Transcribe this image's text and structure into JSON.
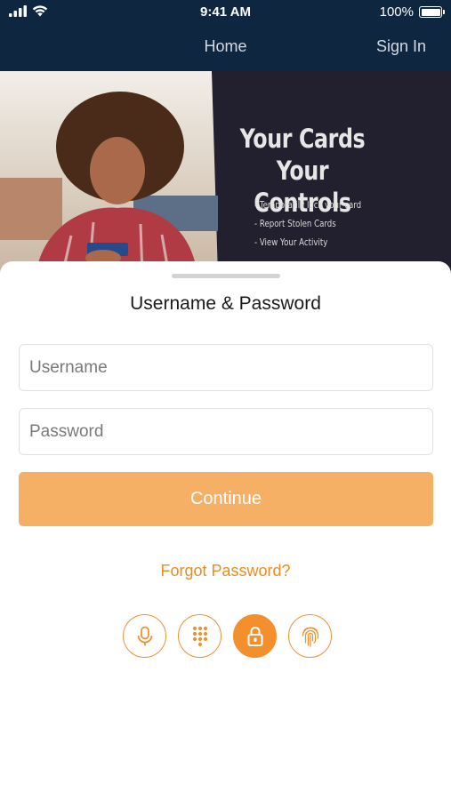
{
  "status_bar": {
    "time": "9:41 AM",
    "battery": "100%"
  },
  "nav": {
    "home": "Home",
    "sign_in": "Sign In"
  },
  "banner": {
    "tagline_1": "Your Cards",
    "tagline_2": "Your Controls",
    "features": [
      "- Temporarily lock your card",
      "- Report Stolen Cards",
      "- View Your Activity"
    ]
  },
  "login": {
    "title": "Username & Password",
    "username_placeholder": "Username",
    "password_placeholder": "Password",
    "continue_label": "Continue",
    "forgot_label": "Forgot Password?"
  },
  "auth_methods": [
    {
      "icon": "microphone-icon",
      "active": false
    },
    {
      "icon": "keypad-icon",
      "active": false
    },
    {
      "icon": "lock-icon",
      "active": true
    },
    {
      "icon": "fingerprint-icon",
      "active": false
    }
  ],
  "colors": {
    "nav_bg": "#0f2641",
    "banner_bg": "#221f2e",
    "accent": "#f3902d",
    "continue_bg": "#f6b066",
    "link": "#ee8b20"
  }
}
